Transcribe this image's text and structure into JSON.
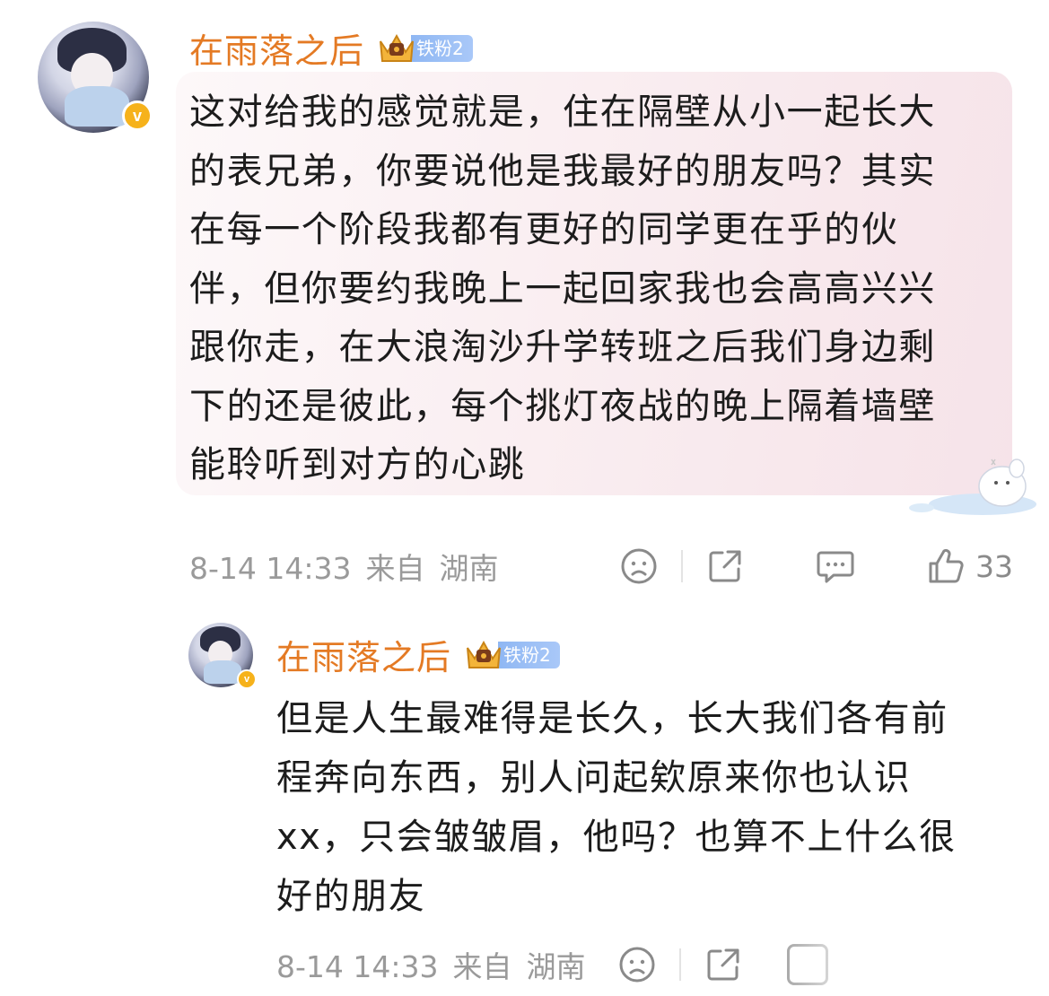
{
  "comments": [
    {
      "username": "在雨落之后",
      "fan_badge": "铁粉2",
      "verified_mark": "v",
      "text": "这对给我的感觉就是，住在隔壁从小一起长大\n的表兄弟，你要说他是我最好的朋友吗？其实\n在每一个阶段我都有更好的同学更在乎的伙\n伴，但你要约我晚上一起回家我也会高高兴兴\n跟你走，在大浪淘沙升学转班之后我们身边剩\n下的还是彼此，每个挑灯夜战的晚上隔着墙壁\n能聆听到对方的心跳",
      "date": "8-14 14:33",
      "from_label": "来自",
      "location": "湖南",
      "like_count": "33",
      "icons": [
        "sad-face-icon",
        "share-icon",
        "comment-icon",
        "like-icon"
      ]
    },
    {
      "username": "在雨落之后",
      "fan_badge": "铁粉2",
      "verified_mark": "v",
      "text": "但是人生最难得是长久，长大我们各有前\n程奔向东西，别人问起欸原来你也认识\nxx，只会皱皱眉，他吗？也算不上什么很\n好的朋友",
      "date": "8-14 14:33",
      "from_label": "来自",
      "location": "湖南"
    }
  ],
  "colors": {
    "username": "#e47a24",
    "meta": "#9a9a9a",
    "bubble": "#f8e9ed",
    "badge_blue": "#8fb7f3",
    "verified": "#f6b21b"
  }
}
